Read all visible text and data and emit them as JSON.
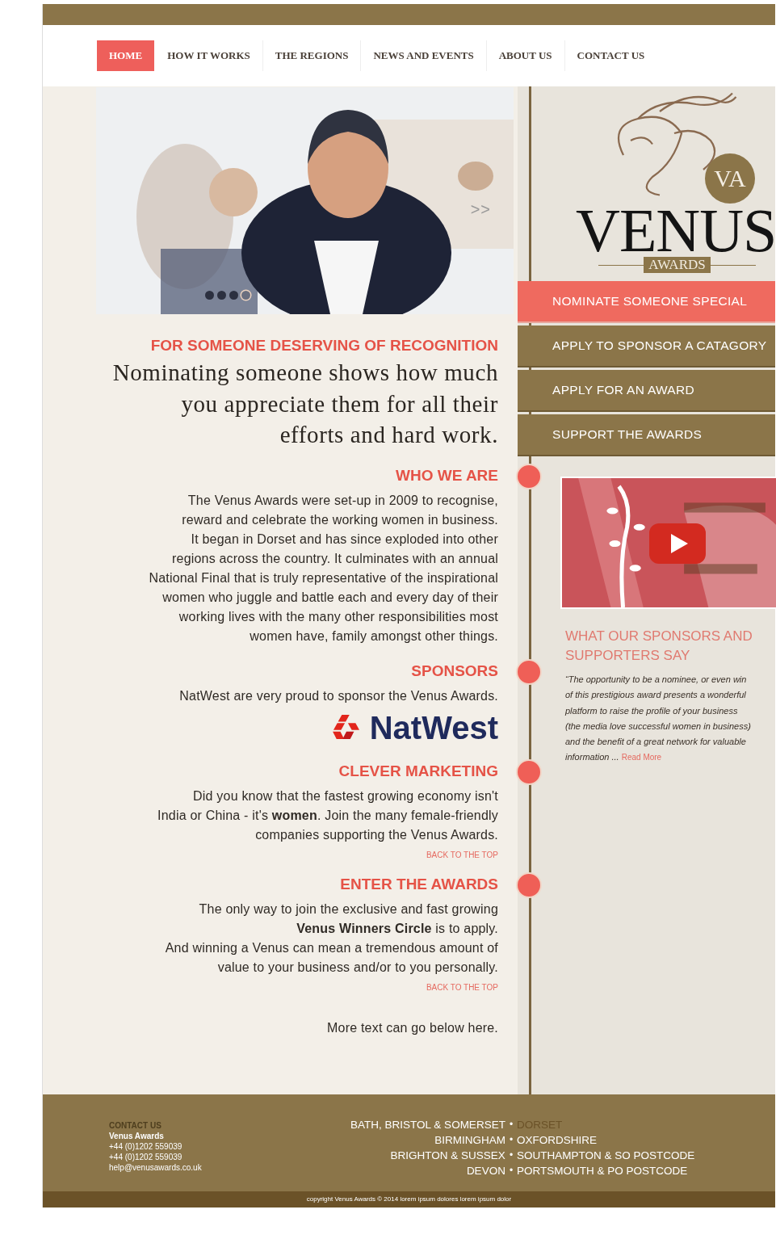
{
  "nav": [
    {
      "label": "HOME",
      "selected": true
    },
    {
      "label": "HOW IT WORKS",
      "selected": false
    },
    {
      "label": "THE REGIONS",
      "selected": false
    },
    {
      "label": "NEWS AND EVENTS",
      "selected": false
    },
    {
      "label": "ABOUT US",
      "selected": false
    },
    {
      "label": "CONTACT US",
      "selected": false
    }
  ],
  "hero": {
    "next_label": ">>",
    "dots": [
      {
        "selected": false
      },
      {
        "selected": false
      },
      {
        "selected": false
      },
      {
        "selected": true
      }
    ]
  },
  "intro": {
    "heading": "FOR SOMEONE DESERVING OF RECOGNITION",
    "lines": [
      "Nominating someone shows how much",
      "you appreciate them for all their",
      "efforts and hard work."
    ]
  },
  "sections": [
    {
      "heading": "WHO WE ARE",
      "lines": [
        "The Venus Awards were set-up in 2009 to recognise,",
        "reward and celebrate the working women in business.",
        "It began in Dorset and has since exploded into other",
        "regions across the country. It culminates with an annual",
        "National Final that is truly representative of the inspirational",
        "women who juggle and battle each and every day of their",
        "working lives with the many other responsibilities most",
        "women have, family amongst other things."
      ]
    },
    {
      "heading": "SPONSORS",
      "lines": [
        "NatWest are very proud to sponsor the Venus Awards."
      ],
      "logo_text": "NatWest"
    },
    {
      "heading": "CLEVER MARKETING",
      "lines": [
        "Did you know that the fastest growing economy isn't",
        "India or China - it's **women**. Join the many female-friendly",
        "companies supporting the Venus Awards."
      ],
      "back_link": "BACK TO THE TOP"
    },
    {
      "heading": "ENTER THE AWARDS",
      "lines": [
        "The only way to join the exclusive and fast growing",
        "**Venus Winners Circle** is to apply.",
        "And winning a Venus can mean a tremendous amount of",
        "value to your business and/or to you personally."
      ],
      "back_link": "BACK TO THE TOP"
    }
  ],
  "more_text": "More text can go below here.",
  "logo": {
    "monogram": "VA",
    "name": "VENUS",
    "subtitle": "AWARDS"
  },
  "menu": [
    {
      "label": "NOMINATE SOMEONE SPECIAL",
      "selected": true
    },
    {
      "label": "APPLY TO SPONSOR A CATAGORY",
      "selected": false
    },
    {
      "label": "APPLY FOR AN AWARD",
      "selected": false
    },
    {
      "label": "SUPPORT THE AWARDS",
      "selected": false
    }
  ],
  "testimonials": {
    "heading": "WHAT OUR SPONSORS AND SUPPORTERS SAY",
    "quote_lines": [
      "“The opportunity to be a nominee, or even win",
      "of this prestigious award presents a wonderful",
      "platform to raise the profile of your business",
      "(the media love successful women in business)",
      "and the benefit of a great network for valuable",
      "information ..."
    ],
    "read_more": "Read More"
  },
  "footer": {
    "contact_heading": "CONTACT US",
    "contact_lines": [
      "Venus Awards",
      "+44 (0)1202 559039",
      "+44 (0)1202 559039",
      "help@venusawards.co.uk"
    ],
    "regions": [
      [
        {
          "label": "BATH, BRISTOL & SOMERSET",
          "selected": false
        },
        {
          "label": "DORSET",
          "selected": true
        }
      ],
      [
        {
          "label": "BIRMINGHAM",
          "selected": false
        },
        {
          "label": "OXFORDSHIRE",
          "selected": false
        }
      ],
      [
        {
          "label": "BRIGHTON & SUSSEX",
          "selected": false
        },
        {
          "label": "SOUTHAMPTON & SO POSTCODE",
          "selected": false
        }
      ],
      [
        {
          "label": "DEVON",
          "selected": false
        },
        {
          "label": "PORTSMOUTH & PO POSTCODE",
          "selected": false
        }
      ]
    ],
    "separator": "•",
    "copyright": "copyright Venus Awards © 2014 lorem ipsum dolores lorem ipsum dolor"
  }
}
